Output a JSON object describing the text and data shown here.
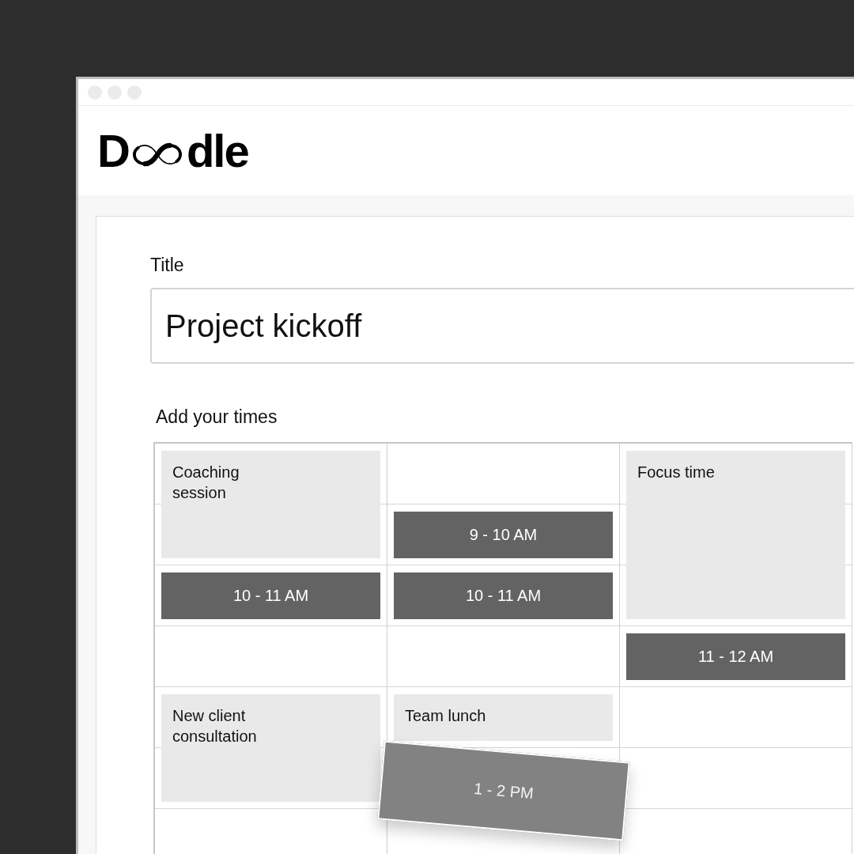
{
  "logo": {
    "initial": "D",
    "rest": "dle"
  },
  "form": {
    "title_label": "Title",
    "title_value": "Project kickoff",
    "times_label": "Add your times"
  },
  "calendar": {
    "columns": [
      {
        "events": [
          {
            "kind": "event",
            "label": "Coaching session",
            "dragging": false
          },
          {
            "kind": "slot",
            "label": "10 - 11 AM",
            "dragging": false
          },
          {
            "kind": "event",
            "label": "New client consultation",
            "dragging": false
          }
        ]
      },
      {
        "events": [
          {
            "kind": "slot",
            "label": "9 - 10 AM",
            "dragging": false
          },
          {
            "kind": "slot",
            "label": "10 - 11 AM",
            "dragging": false
          },
          {
            "kind": "event",
            "label": "Team lunch",
            "dragging": false
          },
          {
            "kind": "slot",
            "label": "1 - 2 PM",
            "dragging": true
          }
        ]
      },
      {
        "events": [
          {
            "kind": "event",
            "label": "Focus time",
            "dragging": false
          },
          {
            "kind": "slot",
            "label": "11 - 12 AM",
            "dragging": false
          }
        ]
      }
    ]
  }
}
